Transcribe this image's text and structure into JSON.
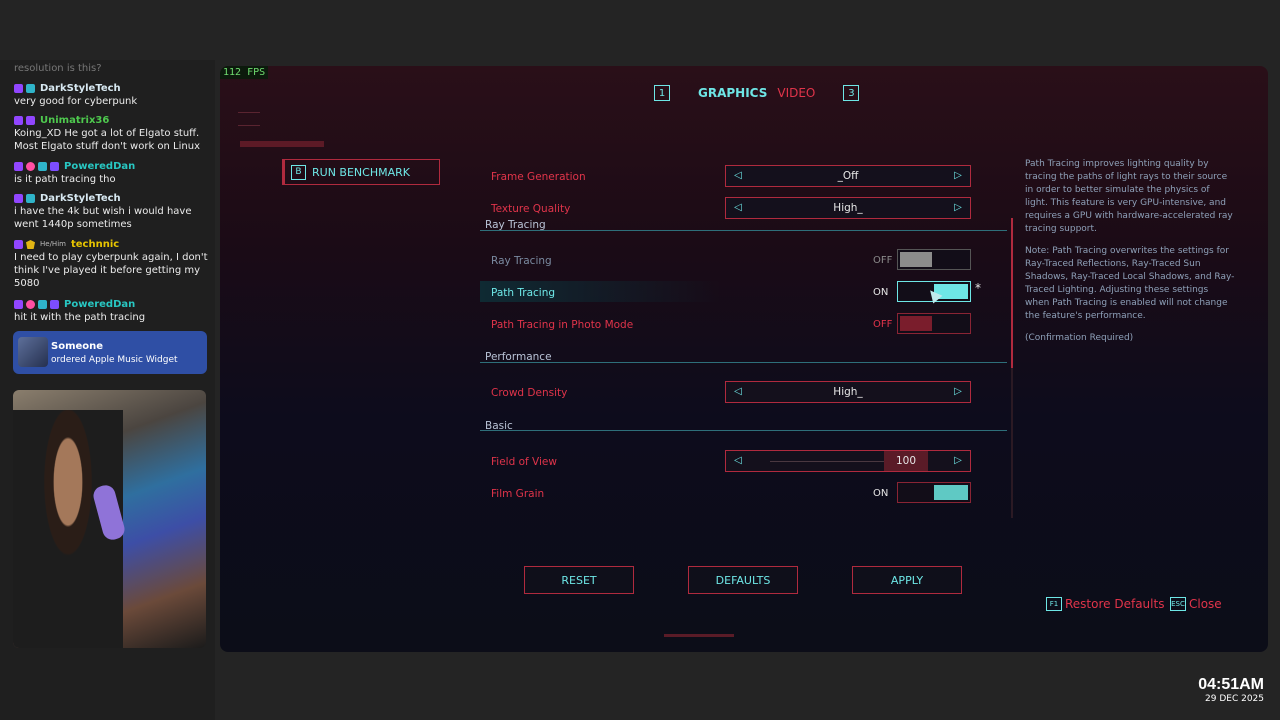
{
  "chat": {
    "top_fragment": "resolution is this?",
    "messages": [
      {
        "user": "DarkStyleTech",
        "color": "#d8e9f2",
        "text": "very good for cyberpunk"
      },
      {
        "user": "Unimatrix36",
        "color": "#4ec94e",
        "text": "Koing_XD He got a lot of Elgato stuff. Most Elgato stuff don't work on Linux"
      },
      {
        "user": "PoweredDan",
        "color": "#28c7c2",
        "text": "is it path tracing tho"
      },
      {
        "user": "DarkStyleTech",
        "color": "#d8e9f2",
        "text": "i have the 4k but wish i would have went 1440p sometimes"
      },
      {
        "user": "technnic",
        "color": "#e8c500",
        "pronoun": "He/Him",
        "text": "I need to play cyberpunk again, I don't think I've played it before getting my 5080"
      },
      {
        "user": "PoweredDan",
        "color": "#28c7c2",
        "text": "hit it with the path tracing"
      }
    ],
    "alert": {
      "name": "Someone",
      "text": "ordered Apple Music Widget"
    }
  },
  "game": {
    "fps": "112 FPS",
    "tabs": {
      "left_key": "1",
      "active": "GRAPHICS",
      "inactive": "VIDEO",
      "right_key": "3"
    },
    "benchmark": {
      "key": "B",
      "label": "RUN BENCHMARK"
    },
    "settings": {
      "frame_generation": {
        "label": "Frame Generation",
        "value": "_Off"
      },
      "texture_quality": {
        "label": "Texture Quality",
        "value": "High_"
      },
      "ray_tracing_section": "Ray Tracing",
      "ray_tracing": {
        "label": "Ray Tracing",
        "state": "OFF"
      },
      "path_tracing": {
        "label": "Path Tracing",
        "state": "ON",
        "mark": "*"
      },
      "path_tracing_photo": {
        "label": "Path Tracing in Photo Mode",
        "state": "OFF"
      },
      "performance_section": "Performance",
      "crowd_density": {
        "label": "Crowd Density",
        "value": "High_"
      },
      "basic_section": "Basic",
      "field_of_view": {
        "label": "Field of View",
        "value": "100"
      },
      "film_grain": {
        "label": "Film Grain",
        "state": "ON"
      }
    },
    "description": {
      "p1": "Path Tracing improves lighting quality by tracing the paths of light rays to their source in order to better simulate the physics of light. This feature is very GPU-intensive, and requires a GPU with hardware-accelerated ray tracing support.",
      "p2": "Note: Path Tracing overwrites the settings for Ray-Traced Reflections, Ray-Traced Sun Shadows, Ray-Traced Local Shadows, and Ray-Traced Lighting. Adjusting these settings when Path Tracing is enabled will not change the feature's performance.",
      "p3": "(Confirmation Required)"
    },
    "buttons": {
      "reset": "RESET",
      "defaults": "DEFAULTS",
      "apply": "APPLY"
    },
    "hints": {
      "restore_key": "F1",
      "restore_label": "Restore Defaults",
      "close_key": "ESC",
      "close_label": "Close"
    }
  },
  "clock": {
    "time": "04:51AM",
    "date": "29 DEC 2025"
  },
  "colors": {
    "accent_cyan": "#6ee6e6",
    "accent_red": "#e0344a",
    "alert_blue": "#2f4fa5"
  }
}
